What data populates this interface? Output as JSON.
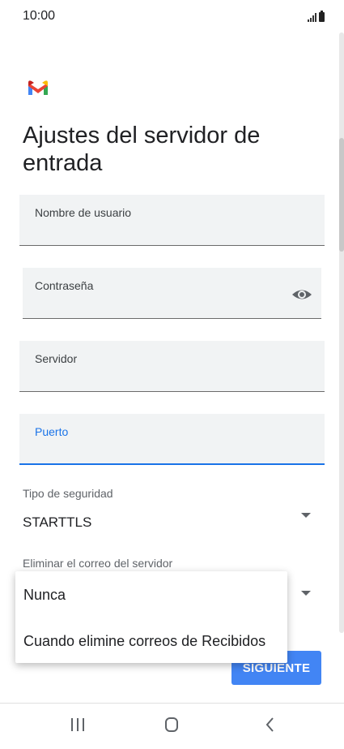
{
  "status_bar": {
    "time": "10:00",
    "signal_icon": "signal-icon",
    "battery_icon": "battery-icon"
  },
  "app": {
    "logo_icon": "gmail-logo-icon"
  },
  "page": {
    "title": "Ajustes del servidor de entrada"
  },
  "form": {
    "username_label": "Nombre de usuario",
    "password_label": "Contraseña",
    "password_toggle_icon": "eye-icon",
    "server_label": "Servidor",
    "port_label": "Puerto",
    "security_label": "Tipo de seguridad",
    "security_value": "STARTTLS",
    "delete_label": "Eliminar el correo del servidor"
  },
  "dropdown": {
    "options": [
      "Nunca",
      "Cuando elimine correos de Recibidos"
    ]
  },
  "actions": {
    "next_label": "SIGUIENTE"
  },
  "nav_bar": {
    "recent_icon": "recent-apps-icon",
    "home_icon": "home-icon",
    "back_icon": "back-icon"
  },
  "colors": {
    "accent": "#1a73e8",
    "button": "#4285f4",
    "field_bg": "#f1f3f4"
  }
}
